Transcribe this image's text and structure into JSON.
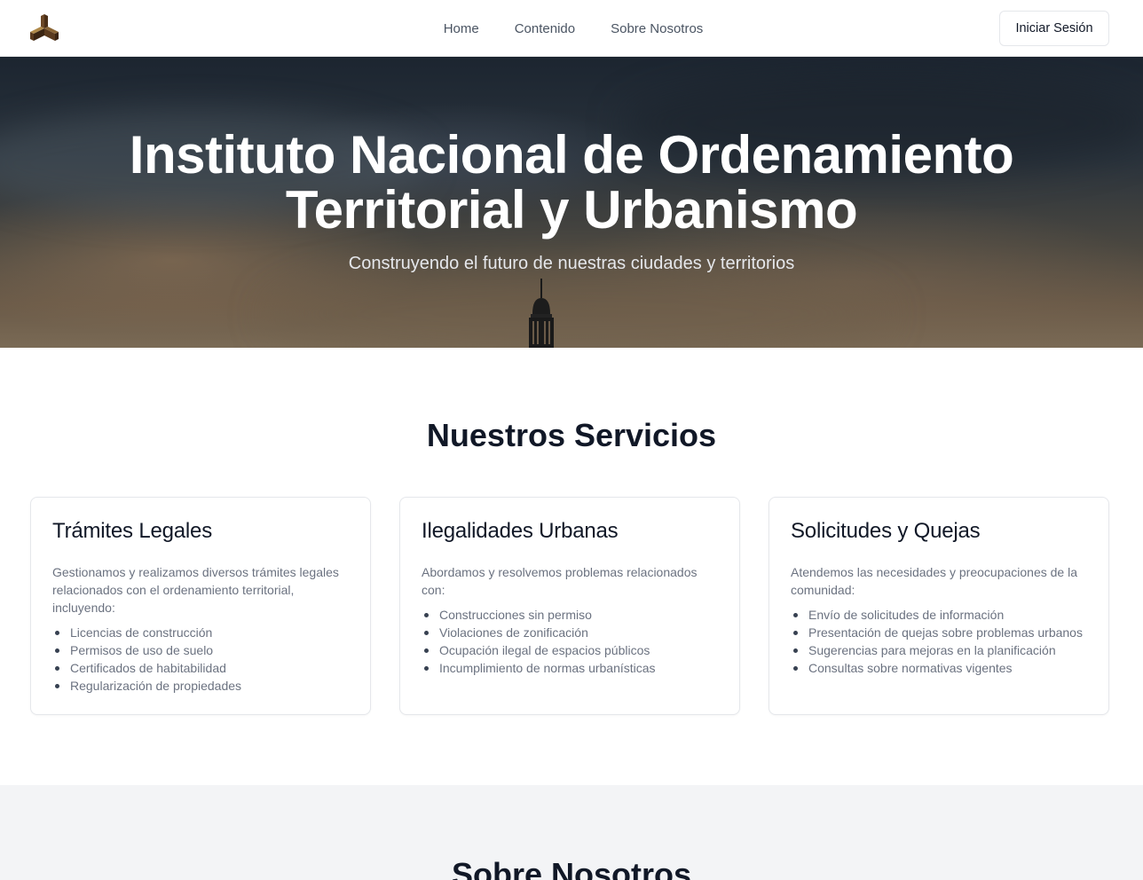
{
  "nav": {
    "logo_icon": "cube-logo-icon",
    "links": [
      "Home",
      "Contenido",
      "Sobre Nosotros"
    ],
    "login_label": "Iniciar Sesión"
  },
  "hero": {
    "title_line1": "Instituto Nacional de Ordenamiento",
    "title_line2": "Territorial y Urbanismo",
    "subtitle": "Construyendo el futuro de nuestras ciudades y territorios"
  },
  "services": {
    "title": "Nuestros Servicios",
    "cards": [
      {
        "title": "Trámites Legales",
        "description": "Gestionamos y realizamos diversos trámites legales relacionados con el ordenamiento territorial, incluyendo:",
        "items": [
          "Licencias de construcción",
          "Permisos de uso de suelo",
          "Certificados de habitabilidad",
          "Regularización de propiedades"
        ]
      },
      {
        "title": "Ilegalidades Urbanas",
        "description": "Abordamos y resolvemos problemas relacionados con:",
        "items": [
          "Construcciones sin permiso",
          "Violaciones de zonificación",
          "Ocupación ilegal de espacios públicos",
          "Incumplimiento de normas urbanísticas"
        ]
      },
      {
        "title": "Solicitudes y Quejas",
        "description": "Atendemos las necesidades y preocupaciones de la comunidad:",
        "items": [
          "Envío de solicitudes de información",
          "Presentación de quejas sobre problemas urbanos",
          "Sugerencias para mejoras en la planificación",
          "Consultas sobre normativas vigentes"
        ]
      }
    ]
  },
  "about": {
    "title": "Sobre Nosotros"
  },
  "colors": {
    "text_dark": "#111827",
    "text_muted": "#6b7280",
    "about_bg": "#f3f4f6",
    "logo_brown": "#5a3a1e",
    "logo_gold": "#b08a4a"
  }
}
